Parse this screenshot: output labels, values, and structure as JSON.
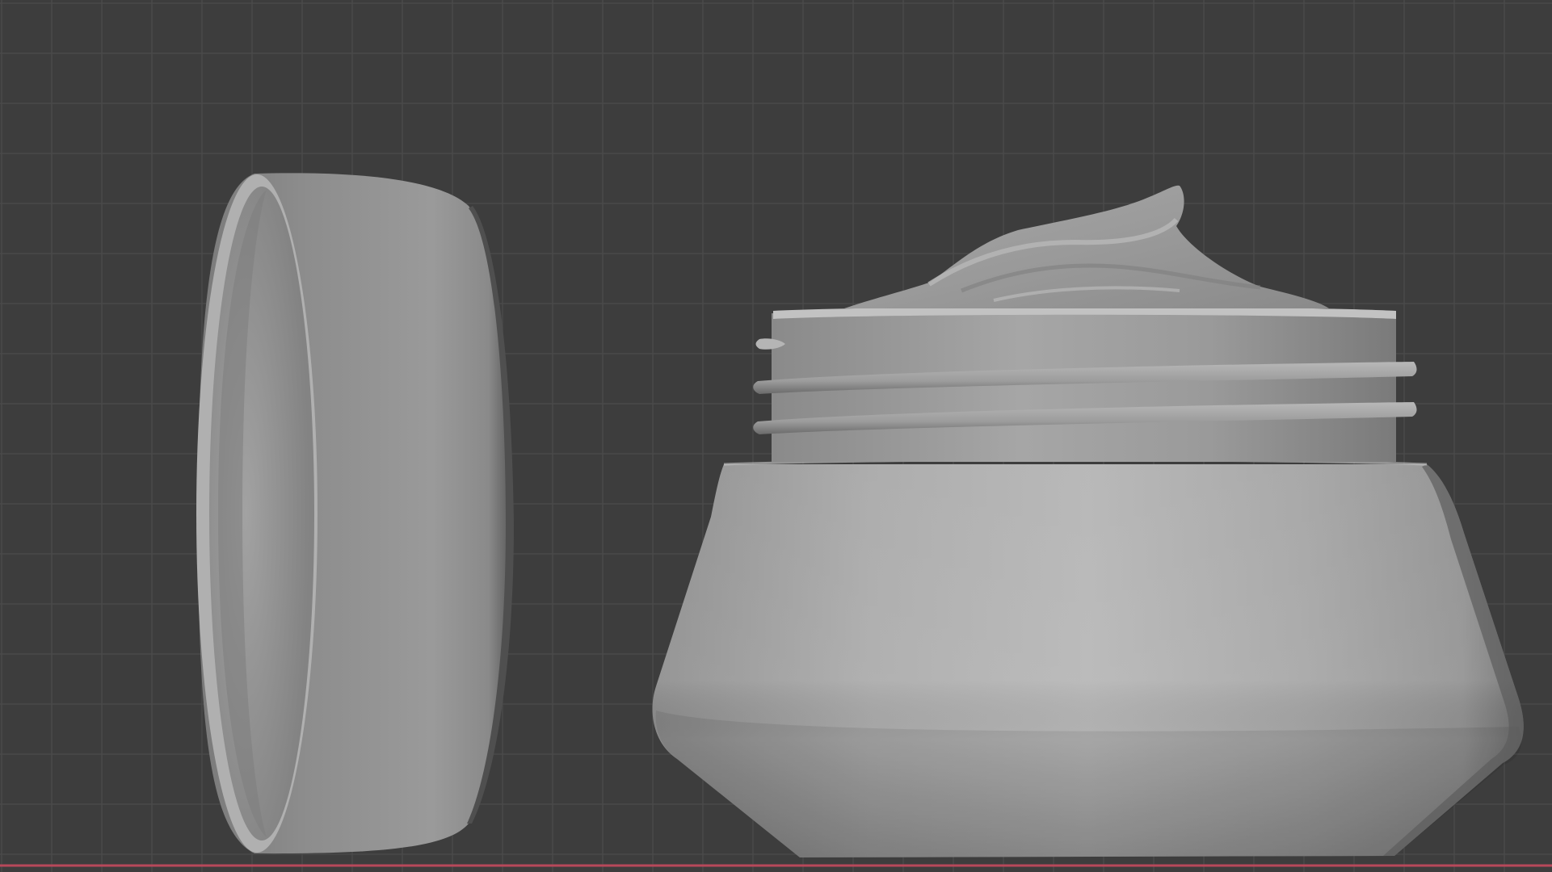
{
  "viewport": {
    "background_color": "#3d3d3d",
    "grid_minor_color": "#4a4a4a",
    "grid_major_color": "#535353",
    "x_axis_color": "#b8485a",
    "mesh_base_color": "#8e8e8e",
    "mesh_highlight_color": "#bdbdbd",
    "mesh_shadow_color": "#5d5d5d"
  },
  "scene": {
    "objects": [
      {
        "name": "jar-lid",
        "icon": "cylinder-mesh-icon"
      },
      {
        "name": "jar-body",
        "icon": "mesh-icon"
      },
      {
        "name": "cream-swirl",
        "icon": "mesh-icon"
      }
    ]
  }
}
